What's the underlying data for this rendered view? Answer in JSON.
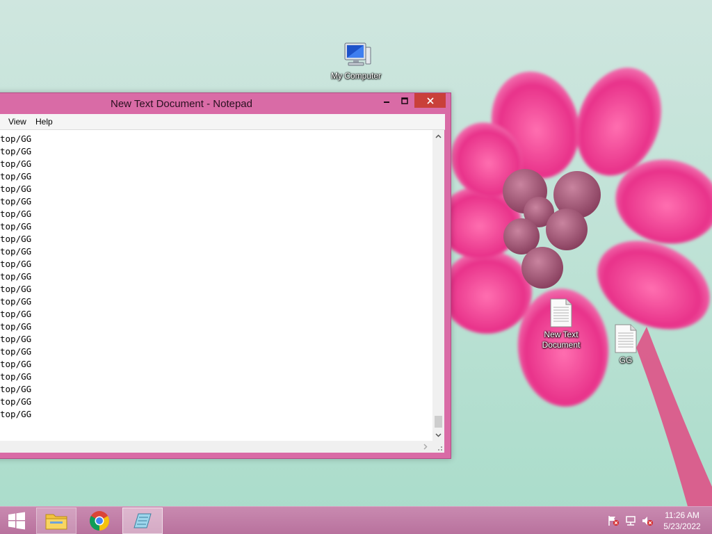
{
  "desktop": {
    "icons": [
      {
        "label": "My Computer",
        "icon": "computer-icon"
      },
      {
        "label_line1": "New Text",
        "label_line2": "Document",
        "icon": "text-document-icon"
      },
      {
        "label": "GG",
        "icon": "text-document-icon"
      }
    ]
  },
  "notepad": {
    "title": "New Text Document - Notepad",
    "menu": {
      "view": "View",
      "help": "Help"
    },
    "lines": [
      "top/GG",
      "top/GG",
      "top/GG",
      "top/GG",
      "top/GG",
      "top/GG",
      "top/GG",
      "top/GG",
      "top/GG",
      "top/GG",
      "top/GG",
      "top/GG",
      "top/GG",
      "top/GG",
      "top/GG",
      "top/GG",
      "top/GG",
      "top/GG",
      "top/GG",
      "top/GG",
      "top/GG",
      "top/GG",
      "top/GG"
    ],
    "colors": {
      "frame": "#d96ba6",
      "close": "#c9403a"
    }
  },
  "taskbar": {
    "pinned": [
      {
        "name": "file-explorer",
        "icon": "folder-icon"
      },
      {
        "name": "chrome",
        "icon": "chrome-icon"
      },
      {
        "name": "notepad",
        "icon": "notepad-icon"
      }
    ],
    "clock": {
      "time": "11:26 AM",
      "date": "5/23/2022"
    }
  }
}
